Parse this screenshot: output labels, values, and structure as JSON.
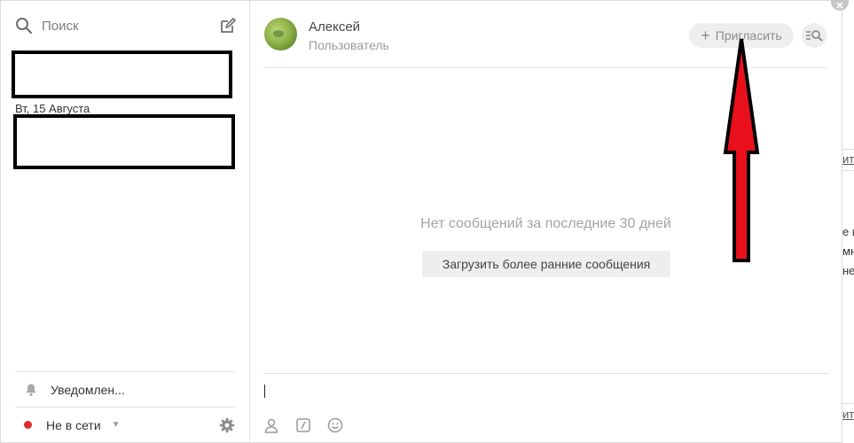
{
  "sidebar": {
    "search": {
      "placeholder": "Поиск"
    },
    "date_label": "Вт, 15 Августа",
    "notifications_label": "Уведомлен...",
    "status_label": "Не в сети",
    "status_color": "#e02a2a"
  },
  "chat": {
    "contact": {
      "name": "Алексей",
      "role": "Пользователь"
    },
    "invite_label": "Пригласить",
    "empty_message": "Нет сообщений за последние 30 дней",
    "load_earlier_label": "Загрузить более ранние сообщения"
  },
  "background_page": {
    "fragments": [
      "ит",
      "е и",
      "мн",
      "не",
      "ит"
    ]
  },
  "annotation": {
    "arrow_color": "#e8101a",
    "outline_color": "#000000"
  },
  "icons": [
    "search-icon",
    "compose-icon",
    "bell-icon",
    "gear-icon",
    "plus-icon",
    "search-messages-icon",
    "person-icon",
    "slash-command-icon",
    "smiley-icon",
    "close-icon"
  ]
}
